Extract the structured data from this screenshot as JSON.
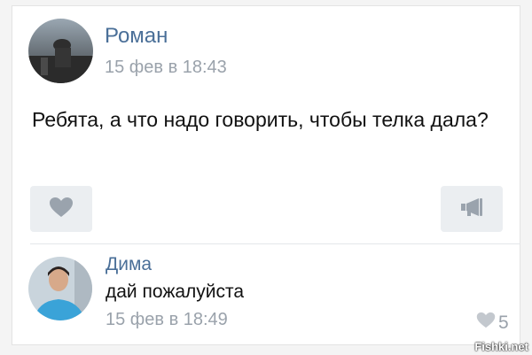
{
  "post": {
    "author": "Роман",
    "date": "15 фев в 18:43",
    "text": "Ребята, а что надо говорить, чтобы телка дала?",
    "like_icon": "heart-icon",
    "share_icon": "megaphone-icon"
  },
  "comment": {
    "author": "Дима",
    "text": "дай пожалуйста",
    "date": "15 фев в 18:49",
    "likes": "5",
    "like_icon": "heart-icon"
  },
  "watermark": "Fishki.net",
  "colors": {
    "name": "#4a6f98",
    "meta": "#9aa2ab",
    "button_bg": "#ebeef1",
    "icon": "#9aa3ad"
  }
}
